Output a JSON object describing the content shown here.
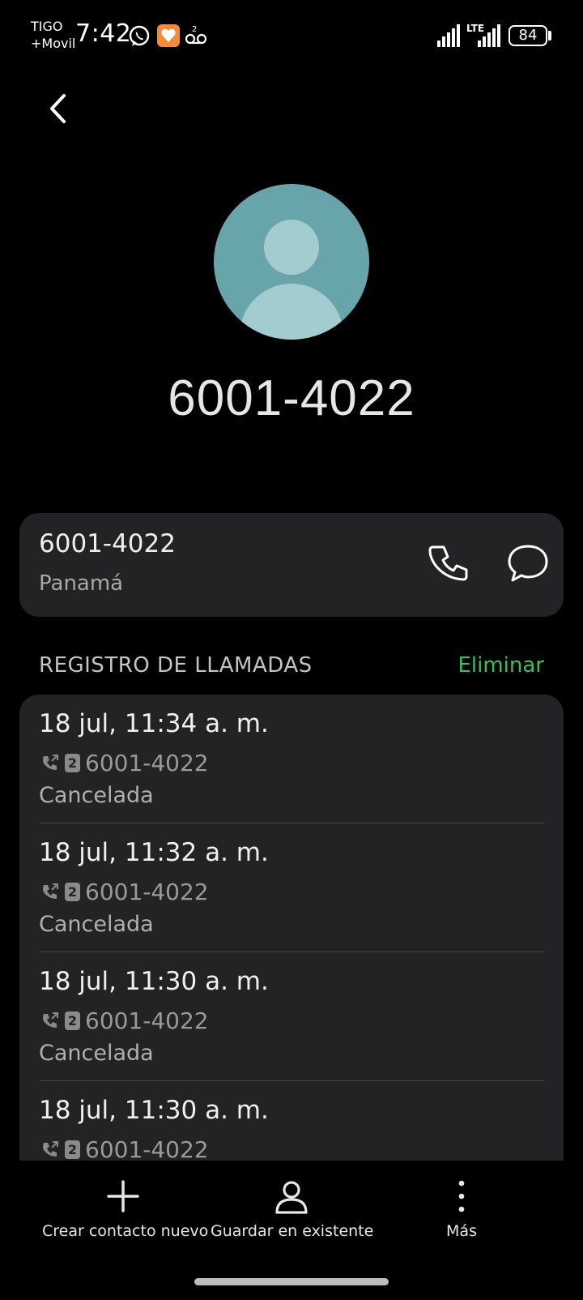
{
  "status_bar": {
    "carrier_line1": "TIGO",
    "carrier_line2": "+Movil",
    "time": "7:42",
    "voicemail_count": "2",
    "network": "LTE",
    "battery": "84"
  },
  "contact": {
    "number": "6001-4022",
    "card_number": "6001-4022",
    "country": "Panamá"
  },
  "call_log": {
    "title": "REGISTRO DE LLAMADAS",
    "delete_label": "Eliminar",
    "entries": [
      {
        "time": "18 jul, 11:34 a. m.",
        "sim": "2",
        "number": "6001-4022",
        "status": "Cancelada"
      },
      {
        "time": "18 jul, 11:32 a. m.",
        "sim": "2",
        "number": "6001-4022",
        "status": "Cancelada"
      },
      {
        "time": "18 jul, 11:30 a. m.",
        "sim": "2",
        "number": "6001-4022",
        "status": "Cancelada"
      },
      {
        "time": "18 jul, 11:30 a. m.",
        "sim": "2",
        "number": "6001-4022",
        "status": ""
      }
    ]
  },
  "actions": {
    "create_new": "Crear contacto nuevo",
    "save_existing": "Guardar en existente",
    "more": "Más"
  },
  "colors": {
    "background": "#000000",
    "card": "#232325",
    "accent_green": "#34c25a",
    "avatar": "#68a5aa"
  },
  "icons": [
    "back-arrow-icon",
    "phone-icon",
    "message-icon",
    "call-log-outgoing-icon",
    "plus-icon",
    "person-icon",
    "more-vertical-icon",
    "whatsapp-icon",
    "health-app-icon",
    "voicemail-icon",
    "signal-icon"
  ]
}
